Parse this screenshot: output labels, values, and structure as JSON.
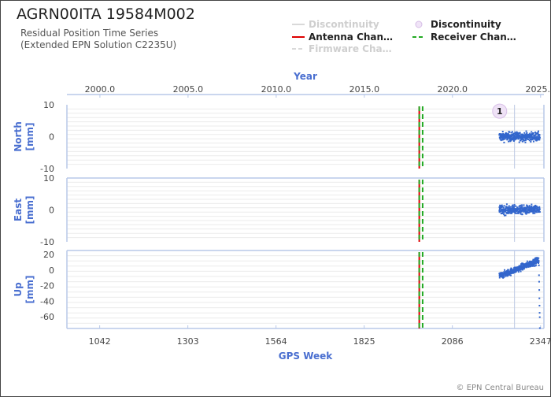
{
  "header": {
    "title": "AGRN00ITA 19584M002",
    "subtitle_line1": "Residual Position Time Series",
    "subtitle_line2": "(Extended EPN Solution C2235U)"
  },
  "legend": {
    "items": [
      {
        "label": "Discontinuity",
        "symbol": "line",
        "color": "#d9d9d9",
        "faded": true
      },
      {
        "label": "Discontinuity",
        "symbol": "circle",
        "color": "#e8d8f0",
        "faded": false
      },
      {
        "label": "Antenna Chan…",
        "symbol": "line",
        "color": "#dd0000",
        "faded": false
      },
      {
        "label": "Receiver Chan…",
        "symbol": "dashed",
        "color": "#22aa22",
        "faded": false
      },
      {
        "label": "Firmware Cha…",
        "symbol": "dashed",
        "color": "#d9d9d9",
        "faded": true
      }
    ]
  },
  "footer": {
    "copyright": "© EPN Central Bureau"
  },
  "colors": {
    "axis_label": "#4a6fd0",
    "data": "#3366cc",
    "antenna_change": "#dd0000",
    "receiver_change": "#22aa22",
    "spine": "#b8c8e8",
    "grid": "#ebebeb"
  },
  "chart_data": {
    "type": "scatter",
    "top_axis": {
      "label": "Year",
      "ticks": [
        2000.0,
        2005.0,
        2010.0,
        2015.0,
        2020.0,
        2025.0
      ],
      "tick_labels": [
        "2000.0",
        "2005.0",
        "2010.0",
        "2015.0",
        "2020.0",
        "2025.0"
      ]
    },
    "bottom_axis": {
      "label": "GPS Week",
      "ticks": [
        1042,
        1303,
        1564,
        1825,
        2086,
        2347
      ],
      "tick_labels": [
        "1042",
        "1303",
        "1564",
        "1825",
        "2086",
        "2347"
      ],
      "xlim": [
        945,
        2357
      ]
    },
    "grid": true,
    "events": {
      "antenna_change_week": 1988,
      "receiver_change_week": 1998,
      "discontinuity_week": 2270,
      "discontinuity_marker": {
        "label": "1",
        "week": 2226,
        "panel": "North",
        "value": 8
      }
    },
    "panels": [
      {
        "name": "North",
        "ylabel_line1": "North",
        "ylabel_line2": "[mm]",
        "ylim": [
          -10,
          10
        ],
        "yticks": [
          10,
          0,
          -10
        ],
        "ytick_labels": [
          "10",
          "0",
          "-10"
        ],
        "series": {
          "x_range_weeks": [
            2225,
            2345
          ],
          "mean": 0,
          "spread": 1.0
        }
      },
      {
        "name": "East",
        "ylabel_line1": "East",
        "ylabel_line2": "[mm]",
        "ylim": [
          -10,
          10
        ],
        "yticks": [
          10,
          0,
          -10
        ],
        "ytick_labels": [
          "10",
          "0",
          "-10"
        ],
        "series": {
          "x_range_weeks": [
            2225,
            2345
          ],
          "mean": 0,
          "spread": 1.0
        }
      },
      {
        "name": "Up",
        "ylabel_line1": "Up",
        "ylabel_line2": "[mm]",
        "ylim": [
          -75,
          25
        ],
        "yticks": [
          20,
          0,
          -20,
          -40,
          -60
        ],
        "ytick_labels": [
          "20",
          "0",
          "-20",
          "-40",
          "-60"
        ],
        "series": {
          "x_range_weeks": [
            2225,
            2345
          ],
          "start": -8,
          "end": 13,
          "spread": 3.0,
          "final_drop": -72
        }
      }
    ]
  }
}
